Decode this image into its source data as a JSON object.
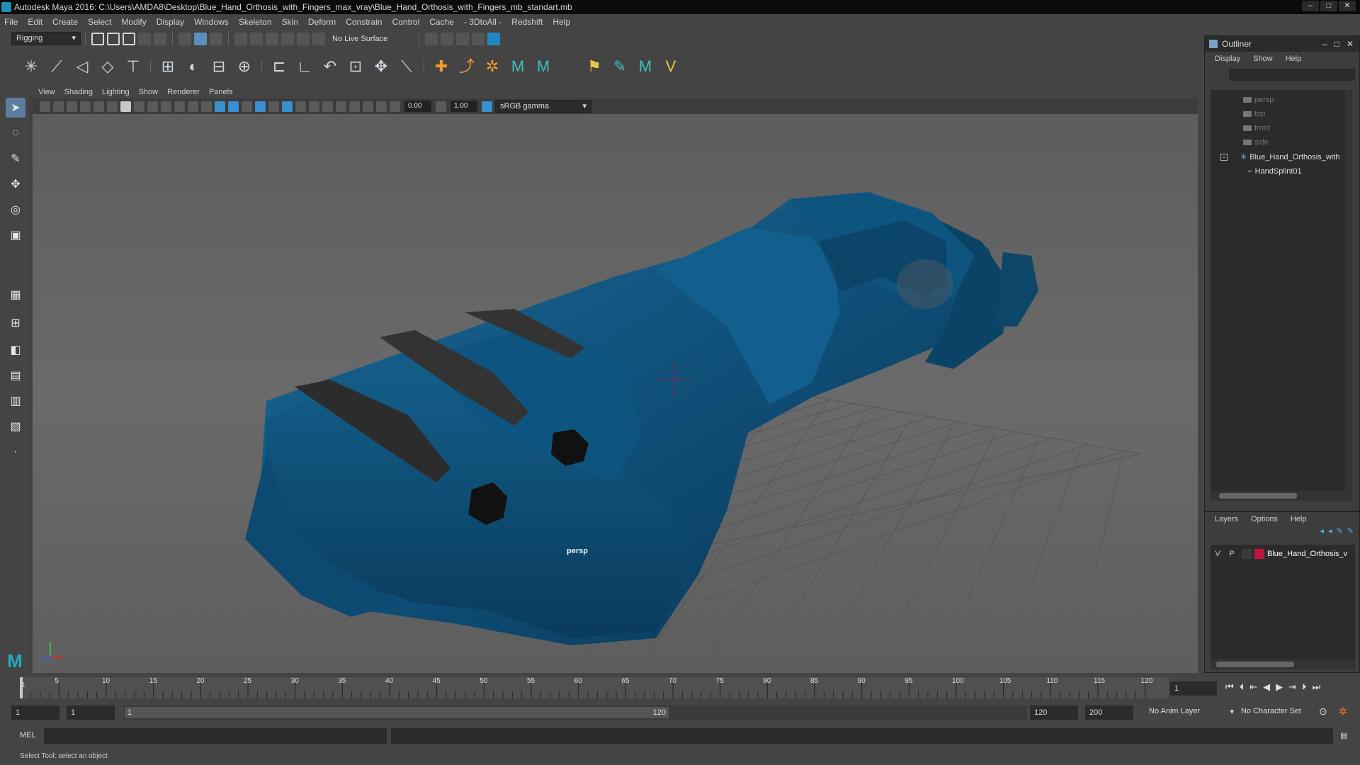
{
  "window": {
    "title": "Autodesk Maya 2016: C:\\Users\\AMDA8\\Desktop\\Blue_Hand_Orthosis_with_Fingers_max_vray\\Blue_Hand_Orthosis_with_Fingers_mb_standart.mb"
  },
  "menubar": [
    "File",
    "Edit",
    "Create",
    "Select",
    "Modify",
    "Display",
    "Windows",
    "Skeleton",
    "Skin",
    "Deform",
    "Constrain",
    "Control",
    "Cache",
    "- 3DtoAll -",
    "Redshift",
    "Help"
  ],
  "toolbar": {
    "mode": "Rigging",
    "live_surface": "No Live Surface"
  },
  "viewport": {
    "menu": [
      "View",
      "Shading",
      "Lighting",
      "Show",
      "Renderer",
      "Panels"
    ],
    "exposure": "0.00",
    "gamma": "1.00",
    "color_space": "sRGB gamma",
    "camera_label": "persp"
  },
  "outliner": {
    "title": "Outliner",
    "menu": [
      "Display",
      "Show",
      "Help"
    ],
    "items": [
      {
        "label": "persp",
        "dim": true
      },
      {
        "label": "top",
        "dim": true
      },
      {
        "label": "front",
        "dim": true
      },
      {
        "label": "side",
        "dim": true
      },
      {
        "label": "Blue_Hand_Orthosis_with",
        "dim": false
      },
      {
        "label": "HandSplint01",
        "dim": false
      }
    ]
  },
  "layers": {
    "menu": [
      "Layers",
      "Options",
      "Help"
    ],
    "layer": {
      "v": "V",
      "p": "P",
      "name": "Blue_Hand_Orthosis_v",
      "color": "#c0143c"
    }
  },
  "timeline": {
    "ticks": [
      "5",
      "10",
      "15",
      "20",
      "25",
      "30",
      "35",
      "40",
      "45",
      "50",
      "55",
      "60",
      "65",
      "70",
      "75",
      "80",
      "85",
      "90",
      "95",
      "100",
      "105",
      "110",
      "115",
      "120"
    ],
    "first_tick": "1",
    "current_frame": "1"
  },
  "range": {
    "start": "1",
    "playback_start": "1",
    "slider_start": "1",
    "slider_end": "120",
    "playback_end": "120",
    "end": "200",
    "anim_layer": "No Anim Layer",
    "char_set": "No Character Set"
  },
  "cmd": {
    "lang": "MEL"
  },
  "status": {
    "help": "Select Tool: select an object"
  },
  "colors": {
    "model_blue": "#0e4f78",
    "accent": "#1f86c0"
  }
}
